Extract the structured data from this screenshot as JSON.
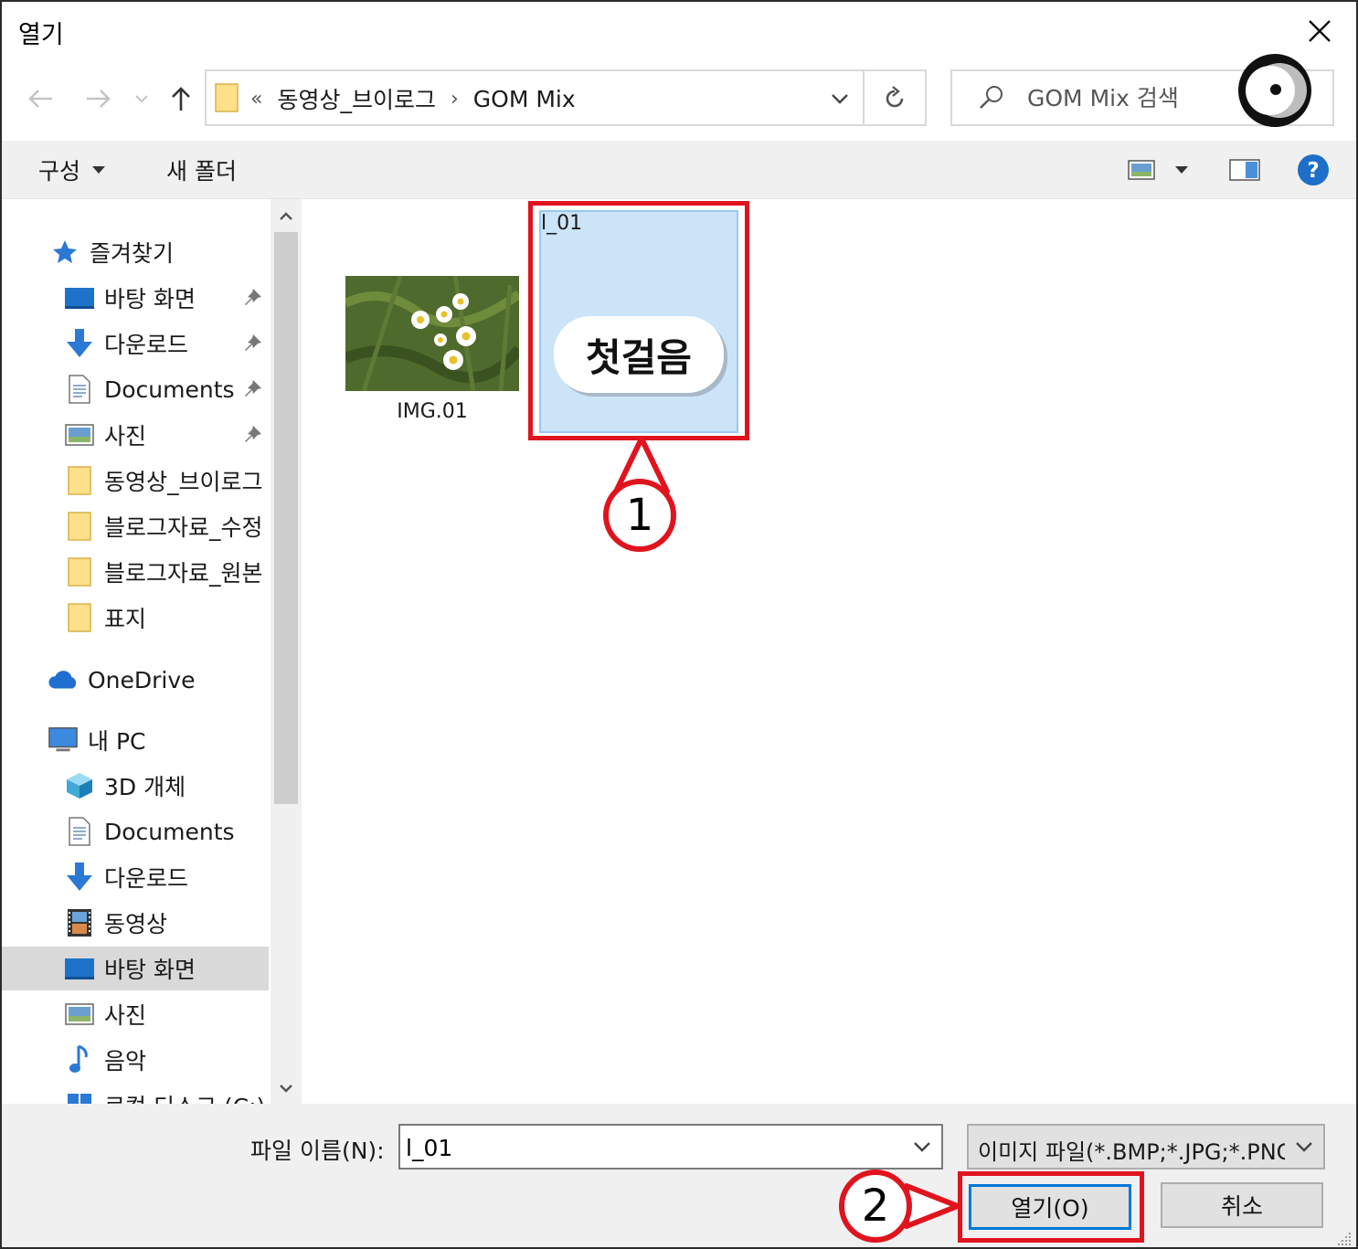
{
  "window": {
    "title": "열기"
  },
  "nav": {
    "breadcrumb_prefix": "«",
    "breadcrumb": [
      "동영상_브이로그",
      "GOM Mix"
    ]
  },
  "search": {
    "placeholder": "GOM Mix 검색"
  },
  "toolbar": {
    "organize": "구성",
    "new_folder": "새 폴더"
  },
  "sidebar": {
    "quick_access": "즐겨찾기",
    "quick_items": [
      {
        "label": "바탕 화면"
      },
      {
        "label": "다운로드"
      },
      {
        "label": "Documents"
      },
      {
        "label": "사진"
      },
      {
        "label": "동영상_브이로그"
      },
      {
        "label": "블로그자료_수정"
      },
      {
        "label": "블로그자료_원본"
      },
      {
        "label": "표지"
      }
    ],
    "onedrive": "OneDrive",
    "this_pc": "내 PC",
    "pc_items": [
      {
        "label": "3D 개체"
      },
      {
        "label": "Documents"
      },
      {
        "label": "다운로드"
      },
      {
        "label": "동영상"
      },
      {
        "label": "바탕 화면"
      },
      {
        "label": "사진"
      },
      {
        "label": "음악"
      },
      {
        "label": "로컬 디스크 (C:)"
      }
    ]
  },
  "files": [
    {
      "name": "IMG.01"
    },
    {
      "name": "l_01",
      "badge_text": "첫걸음"
    }
  ],
  "annotations": {
    "step1": "1",
    "step2": "2"
  },
  "bottom": {
    "filename_label": "파일 이름(N):",
    "filename_value": "l_01",
    "filter": "이미지 파일(*.BMP;*.JPG;*.PNG",
    "open_button": "열기(O)",
    "cancel_button": "취소"
  },
  "colors": {
    "highlight": "#e0141e",
    "selection": "#cce4f7",
    "accent": "#0078d7"
  }
}
